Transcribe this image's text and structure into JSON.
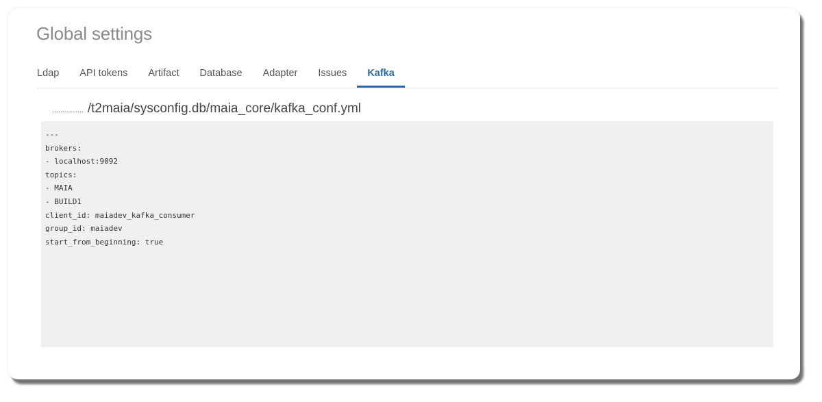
{
  "page": {
    "title": "Global settings"
  },
  "tabs": [
    {
      "label": "Ldap",
      "active": false
    },
    {
      "label": "API tokens",
      "active": false
    },
    {
      "label": "Artifact",
      "active": false
    },
    {
      "label": "Database",
      "active": false
    },
    {
      "label": "Adapter",
      "active": false
    },
    {
      "label": "Issues",
      "active": false
    },
    {
      "label": "Kafka",
      "active": true
    }
  ],
  "file": {
    "dots": "...............",
    "path": "/t2maia/sysconfig.db/maia_core/kafka_conf.yml"
  },
  "editor": {
    "lines": [
      "---",
      "brokers:",
      "- localhost:9092",
      "topics:",
      "- MAIA",
      "- BUILD1",
      "client_id: maiadev_kafka_consumer",
      "group_id: maiadev",
      "start_from_beginning: true"
    ]
  },
  "colors": {
    "accent": "#2a6bb0",
    "title": "#8a8a8a",
    "editor_bg": "#f0f0f0"
  }
}
